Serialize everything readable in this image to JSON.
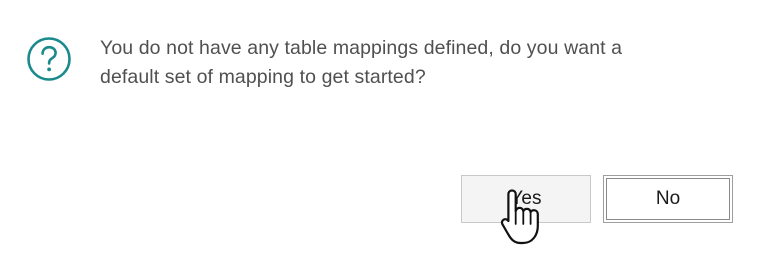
{
  "dialog": {
    "icon": "question-circle-icon",
    "message_line1": "You do not have any table mappings defined, do you want a",
    "message_line2": "default set of mapping to get started?",
    "accent_color": "#1a8a8c"
  },
  "buttons": {
    "yes_label": "Yes",
    "no_label": "No"
  },
  "cursor": {
    "icon": "hand-pointer-icon"
  }
}
